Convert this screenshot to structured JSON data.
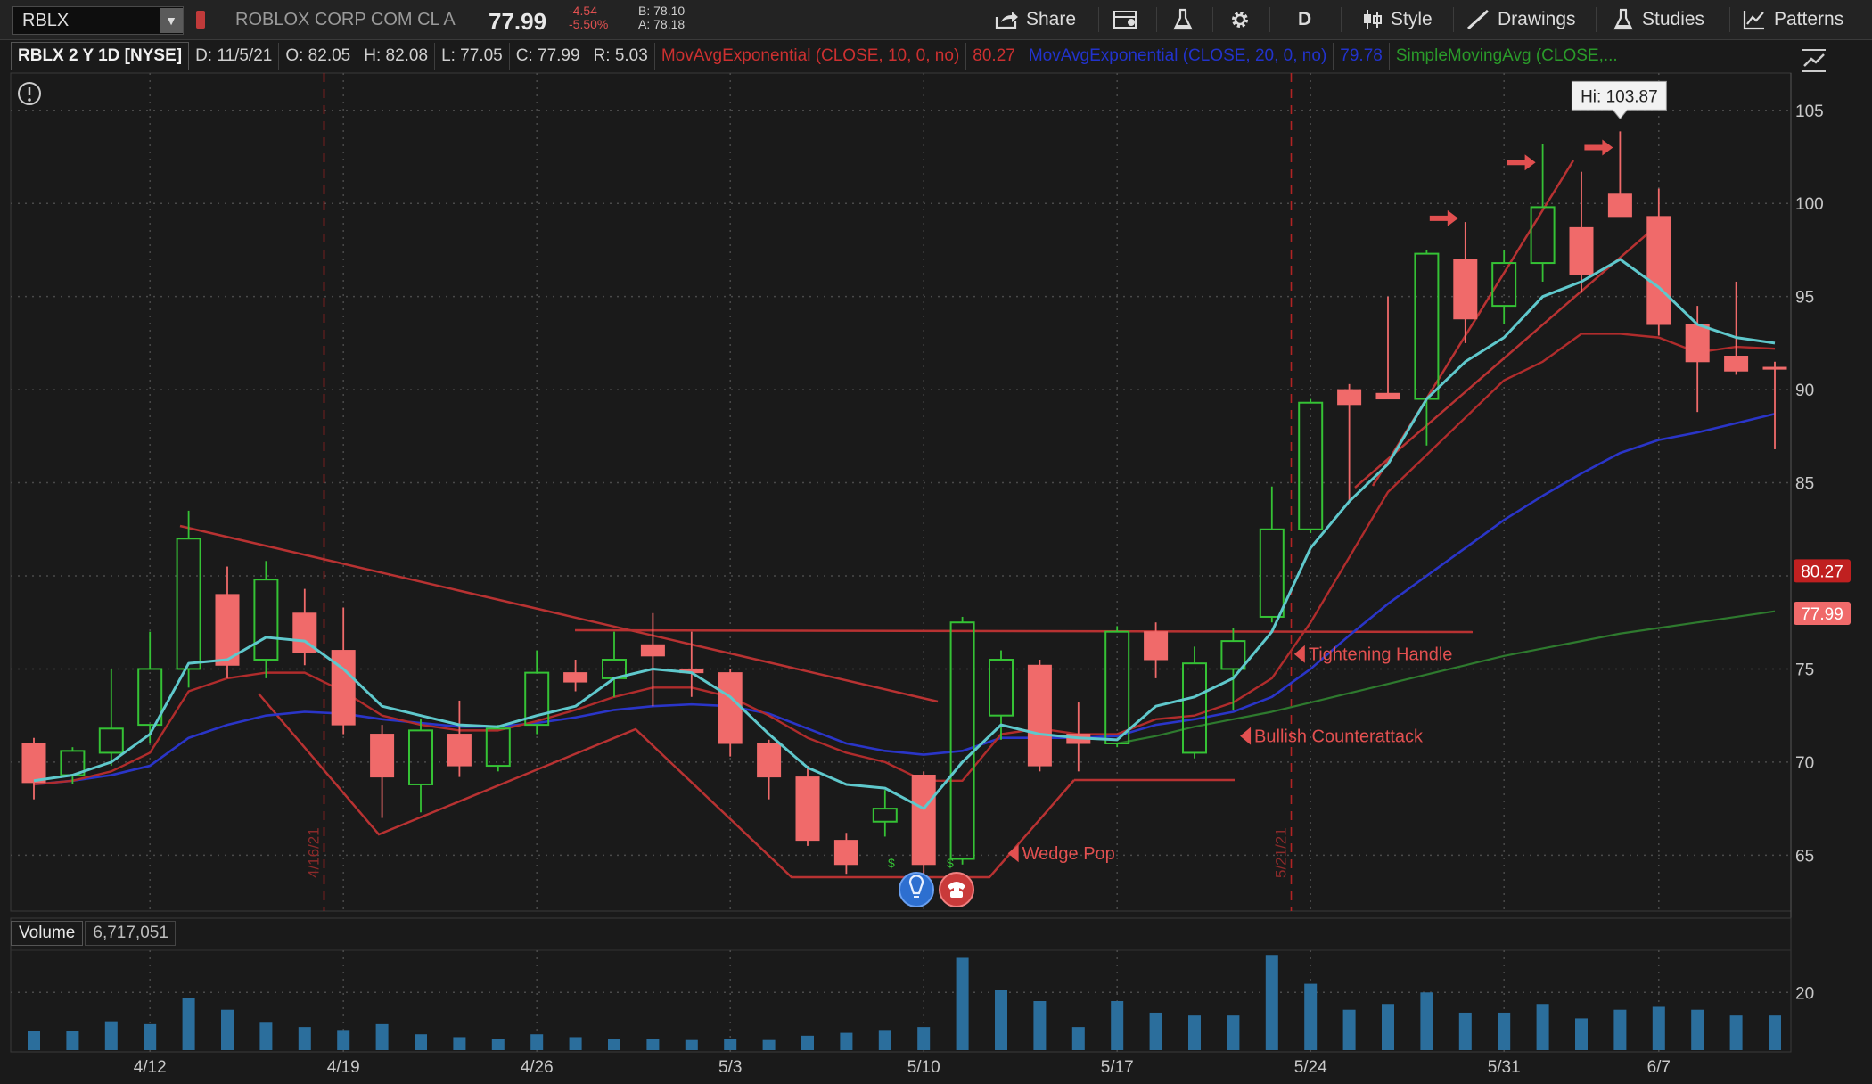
{
  "toolbar": {
    "symbol": "RBLX",
    "company": "ROBLOX CORP COM CL A",
    "last": "77.99",
    "change": "-4.54",
    "change_pct": "-5.50%",
    "bid": "B: 78.10",
    "ask": "A: 78.18",
    "share_label": "Share",
    "period_label": "D",
    "style_label": "Style",
    "drawings_label": "Drawings",
    "studies_label": "Studies",
    "patterns_label": "Patterns"
  },
  "infobar": {
    "title": "RBLX 2 Y 1D [NYSE]",
    "date": "D: 11/5/21",
    "open": "O: 82.05",
    "high": "H: 82.08",
    "low": "L: 77.05",
    "close": "C: 77.99",
    "range": "R: 5.03",
    "ema10_label": "MovAvgExponential (CLOSE, 10, 0, no)",
    "ema10_value": "80.27",
    "ema20_label": "MovAvgExponential (CLOSE, 20, 0, no)",
    "ema20_value": "79.78",
    "sma_label": "SimpleMovingAvg (CLOSE,..."
  },
  "volume_panel": {
    "label": "Volume",
    "value": "6,717,051"
  },
  "colors": {
    "up": "#35c235",
    "down": "#f06a6a",
    "ema_fast": "#5fc8cc",
    "ema_red": "#b02c2c",
    "ema_blue": "#2a35c8",
    "sma_green": "#2e7a2e",
    "volume": "#2b6e9c",
    "grid": "#4a4a4a"
  },
  "chart_data": {
    "type": "candlestick",
    "ylim": [
      62,
      107
    ],
    "yticks": [
      65,
      70,
      75,
      80,
      85,
      90,
      95,
      100,
      105
    ],
    "xticks": [
      {
        "label": "4/12",
        "i": 3
      },
      {
        "label": "4/19",
        "i": 8
      },
      {
        "label": "4/26",
        "i": 13
      },
      {
        "label": "5/3",
        "i": 18
      },
      {
        "label": "5/10",
        "i": 23
      },
      {
        "label": "5/17",
        "i": 28
      },
      {
        "label": "5/24",
        "i": 33
      },
      {
        "label": "5/31",
        "i": 38
      },
      {
        "label": "6/7",
        "i": 42
      }
    ],
    "date_markers": [
      {
        "label": "4/16/21",
        "i": 7.5
      },
      {
        "label": "5/21/21",
        "i": 32.5
      }
    ],
    "candles": [
      {
        "o": 71,
        "h": 71.3,
        "l": 68,
        "c": 68.9
      },
      {
        "o": 69.3,
        "h": 70.8,
        "l": 68.8,
        "c": 70.6
      },
      {
        "o": 70.5,
        "h": 75,
        "l": 69.8,
        "c": 71.8
      },
      {
        "o": 72,
        "h": 77,
        "l": 71,
        "c": 75
      },
      {
        "o": 75,
        "h": 83.5,
        "l": 74,
        "c": 82
      },
      {
        "o": 79,
        "h": 80.5,
        "l": 74.5,
        "c": 75.2
      },
      {
        "o": 75.5,
        "h": 80.8,
        "l": 74.5,
        "c": 79.8
      },
      {
        "o": 78,
        "h": 79.3,
        "l": 75.2,
        "c": 75.9
      },
      {
        "o": 76,
        "h": 78.3,
        "l": 71.5,
        "c": 72
      },
      {
        "o": 71.5,
        "h": 72,
        "l": 67,
        "c": 69.2
      },
      {
        "o": 68.8,
        "h": 72.3,
        "l": 67.3,
        "c": 71.7
      },
      {
        "o": 71.5,
        "h": 73.3,
        "l": 69.2,
        "c": 69.8
      },
      {
        "o": 69.8,
        "h": 72,
        "l": 69.5,
        "c": 71.8
      },
      {
        "o": 72,
        "h": 76,
        "l": 71.5,
        "c": 74.8
      },
      {
        "o": 74.8,
        "h": 75.5,
        "l": 73.8,
        "c": 74.3
      },
      {
        "o": 74.5,
        "h": 77,
        "l": 73.5,
        "c": 75.5
      },
      {
        "o": 76.3,
        "h": 78,
        "l": 73,
        "c": 75.7
      },
      {
        "o": 75,
        "h": 77,
        "l": 73.5,
        "c": 74.8
      },
      {
        "o": 74.8,
        "h": 75,
        "l": 70.3,
        "c": 71
      },
      {
        "o": 71,
        "h": 71.2,
        "l": 68,
        "c": 69.2
      },
      {
        "o": 69.2,
        "h": 69.8,
        "l": 65.5,
        "c": 65.8
      },
      {
        "o": 65.8,
        "h": 66.2,
        "l": 64,
        "c": 64.5
      },
      {
        "o": 66.8,
        "h": 68.5,
        "l": 66,
        "c": 67.5
      },
      {
        "o": 69.3,
        "h": 69.5,
        "l": 63.8,
        "c": 64.5
      },
      {
        "o": 64.8,
        "h": 77.8,
        "l": 64.5,
        "c": 77.5
      },
      {
        "o": 72.5,
        "h": 76,
        "l": 71.2,
        "c": 75.5
      },
      {
        "o": 75.2,
        "h": 75.5,
        "l": 69.5,
        "c": 69.8
      },
      {
        "o": 71.5,
        "h": 73.2,
        "l": 69.5,
        "c": 71
      },
      {
        "o": 71,
        "h": 77.3,
        "l": 70.8,
        "c": 77
      },
      {
        "o": 77,
        "h": 77.5,
        "l": 74.5,
        "c": 75.5
      },
      {
        "o": 70.5,
        "h": 76.2,
        "l": 70.2,
        "c": 75.3
      },
      {
        "o": 75,
        "h": 77.2,
        "l": 72.8,
        "c": 76.5
      },
      {
        "o": 77.8,
        "h": 84.8,
        "l": 77.5,
        "c": 82.5
      },
      {
        "o": 82.5,
        "h": 89.5,
        "l": 82.3,
        "c": 89.3
      },
      {
        "o": 90,
        "h": 90.3,
        "l": 84,
        "c": 89.2
      },
      {
        "o": 89.8,
        "h": 95,
        "l": 89.5,
        "c": 89.5
      },
      {
        "o": 89.5,
        "h": 97.5,
        "l": 87,
        "c": 97.3
      },
      {
        "o": 97,
        "h": 99,
        "l": 92.5,
        "c": 93.8
      },
      {
        "o": 94.5,
        "h": 97.5,
        "l": 93.5,
        "c": 96.8
      },
      {
        "o": 96.8,
        "h": 103.2,
        "l": 95.8,
        "c": 99.8
      },
      {
        "o": 98.7,
        "h": 101.7,
        "l": 95.2,
        "c": 96.2
      },
      {
        "o": 100.5,
        "h": 103.87,
        "l": 99.3,
        "c": 99.3
      },
      {
        "o": 99.3,
        "h": 100.8,
        "l": 92.9,
        "c": 93.5
      },
      {
        "o": 93.5,
        "h": 94.5,
        "l": 88.8,
        "c": 91.5
      },
      {
        "o": 91.8,
        "h": 95.8,
        "l": 90.8,
        "c": 91
      },
      {
        "o": 91.2,
        "h": 91.5,
        "l": 86.8,
        "c": 91.1
      }
    ],
    "ema_fast": [
      69.0,
      69.3,
      70.0,
      71.5,
      75.3,
      75.5,
      76.7,
      76.5,
      75.0,
      73.0,
      72.5,
      72.0,
      71.9,
      72.5,
      73.0,
      74.5,
      75.0,
      74.8,
      73.5,
      71.5,
      69.7,
      68.8,
      68.6,
      67.5,
      70.0,
      72.0,
      71.5,
      71.3,
      71.2,
      73.0,
      73.5,
      74.5,
      77.0,
      81.5,
      84.0,
      86.0,
      89.5,
      91.5,
      92.8,
      95.0,
      95.8,
      97.0,
      95.5,
      93.5,
      92.8,
      92.5
    ],
    "ema10": [
      68.8,
      69.0,
      69.5,
      70.5,
      73.8,
      74.5,
      74.8,
      74.8,
      73.8,
      72.5,
      72.0,
      71.7,
      71.7,
      72.2,
      72.8,
      73.5,
      74.0,
      74.0,
      73.5,
      72.5,
      71.3,
      70.5,
      70.0,
      69.0,
      69.0,
      71.5,
      71.8,
      71.5,
      71.5,
      72.3,
      72.5,
      73.2,
      74.5,
      77.5,
      81.0,
      84.5,
      86.5,
      88.5,
      90.5,
      91.5,
      93.0,
      93.0,
      92.8,
      92.0,
      92.3,
      92.2
    ],
    "ema20": [
      68.8,
      69.0,
      69.3,
      69.8,
      71.3,
      72.0,
      72.5,
      72.7,
      72.6,
      72.3,
      72.1,
      71.9,
      71.9,
      72.1,
      72.4,
      72.8,
      73.0,
      73.1,
      73.0,
      72.6,
      71.8,
      71.0,
      70.6,
      70.4,
      70.6,
      71.3,
      71.3,
      71.3,
      71.4,
      72.0,
      72.3,
      72.7,
      73.5,
      75.0,
      76.8,
      78.5,
      80.0,
      81.5,
      83.0,
      84.3,
      85.5,
      86.6,
      87.3,
      87.7,
      88.2,
      88.7
    ],
    "sma": [
      null,
      null,
      null,
      null,
      null,
      null,
      null,
      null,
      null,
      null,
      null,
      null,
      null,
      null,
      null,
      null,
      null,
      null,
      null,
      null,
      null,
      null,
      null,
      null,
      null,
      null,
      null,
      null,
      71.0,
      71.4,
      71.9,
      72.3,
      72.7,
      73.2,
      73.7,
      74.2,
      74.7,
      75.2,
      75.7,
      76.1,
      76.5,
      76.9,
      77.2,
      77.5,
      77.8,
      78.1
    ],
    "volume": [
      6.5,
      6.5,
      10,
      9,
      18,
      14,
      9.5,
      8,
      7,
      9,
      5.5,
      4.5,
      4,
      5.5,
      4.5,
      4,
      4,
      3.5,
      4,
      3.5,
      5,
      6,
      7,
      8,
      32,
      21,
      17,
      8,
      17,
      13,
      12,
      12,
      33,
      23,
      14,
      16,
      20,
      13,
      13,
      16,
      11,
      14,
      15,
      14,
      12,
      12
    ],
    "volume_ticks": [
      20
    ],
    "annotations": [
      {
        "text": "Hi: 103.87"
      },
      {
        "text": "Tightening Handle"
      },
      {
        "text": "Bullish Counterattack"
      },
      {
        "text": "Wedge  Pop"
      }
    ],
    "price_badges": [
      {
        "value": "80.27",
        "color": "#c02020"
      },
      {
        "value": "77.99",
        "color": "#f06a6a"
      }
    ]
  }
}
